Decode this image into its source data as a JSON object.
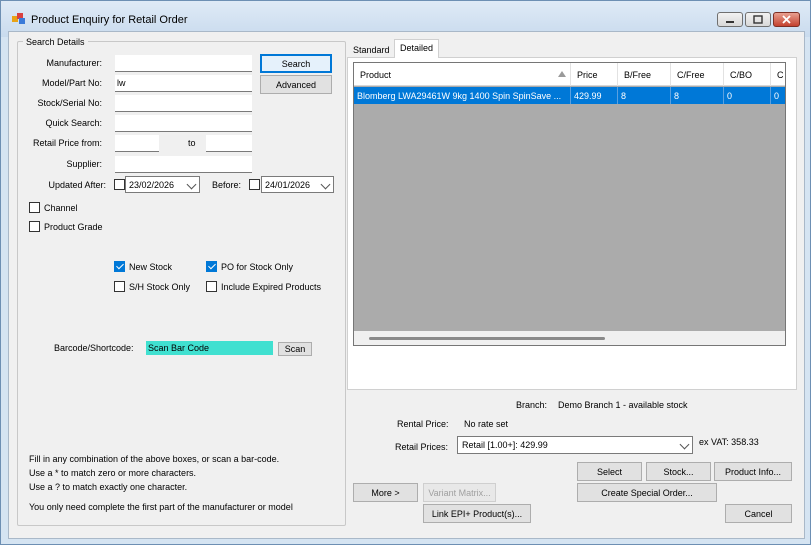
{
  "window": {
    "title": "Product Enquiry for Retail Order"
  },
  "search": {
    "group_title": "Search Details",
    "manufacturer_label": "Manufacturer:",
    "manufacturer_value": "",
    "model_label": "Model/Part No:",
    "model_value": "lw",
    "stock_label": "Stock/Serial No:",
    "stock_value": "",
    "quick_label": "Quick Search:",
    "quick_value": "",
    "price_from_label": "Retail Price from:",
    "price_from_value": "",
    "to_label": "to",
    "price_to_value": "",
    "supplier_label": "Supplier:",
    "supplier_value": "",
    "updated_after_label": "Updated After:",
    "updated_after_date": "23/02/2026",
    "before_label": "Before:",
    "before_date": "24/01/2026",
    "search_button": "Search",
    "advanced_button": "Advanced"
  },
  "options": {
    "channel": "Channel",
    "product_grade": "Product Grade",
    "new_stock": "New Stock",
    "new_stock_checked": true,
    "po_for_stock_only": "PO for Stock Only",
    "po_for_stock_only_checked": true,
    "sh_stock_only": "S/H Stock Only",
    "include_expired": "Include Expired Products"
  },
  "barcode": {
    "label": "Barcode/Shortcode:",
    "value": "Scan Bar Code",
    "scan_button": "Scan"
  },
  "help": {
    "line1": "Fill in any combination of the above boxes, or scan a bar-code.",
    "line2": "Use a * to match zero or more characters.",
    "line3": "Use a ? to match exactly one character.",
    "line4": "You only need complete the first part of the manufacturer or model"
  },
  "tabs": {
    "standard": "Standard",
    "detailed": "Detailed"
  },
  "grid": {
    "columns": [
      "Product",
      "Price",
      "B/Free",
      "C/Free",
      "C/BO",
      "C"
    ],
    "rows": [
      [
        "Blomberg LWA29461W 9kg 1400 Spin SpinSave ...",
        "429.99",
        "8",
        "8",
        "0",
        "0"
      ]
    ]
  },
  "details": {
    "branch_label": "Branch:",
    "branch_value": "Demo Branch 1 - available stock",
    "rental_label": "Rental Price:",
    "rental_value": "No rate set",
    "retail_label": "Retail Prices:",
    "retail_value": "Retail [1.00+]: 429.99",
    "ex_vat": "ex VAT: 358.33"
  },
  "buttons": {
    "select": "Select",
    "stock": "Stock...",
    "product_info": "Product Info...",
    "more": "More >",
    "variant_matrix": "Variant Matrix...",
    "create_special_order": "Create Special Order...",
    "link_epi": "Link EPI+ Product(s)...",
    "cancel": "Cancel"
  },
  "colors": {
    "selection": "#0078d7",
    "scan_field": "#40e0d0",
    "grid_background": "#ababab"
  }
}
